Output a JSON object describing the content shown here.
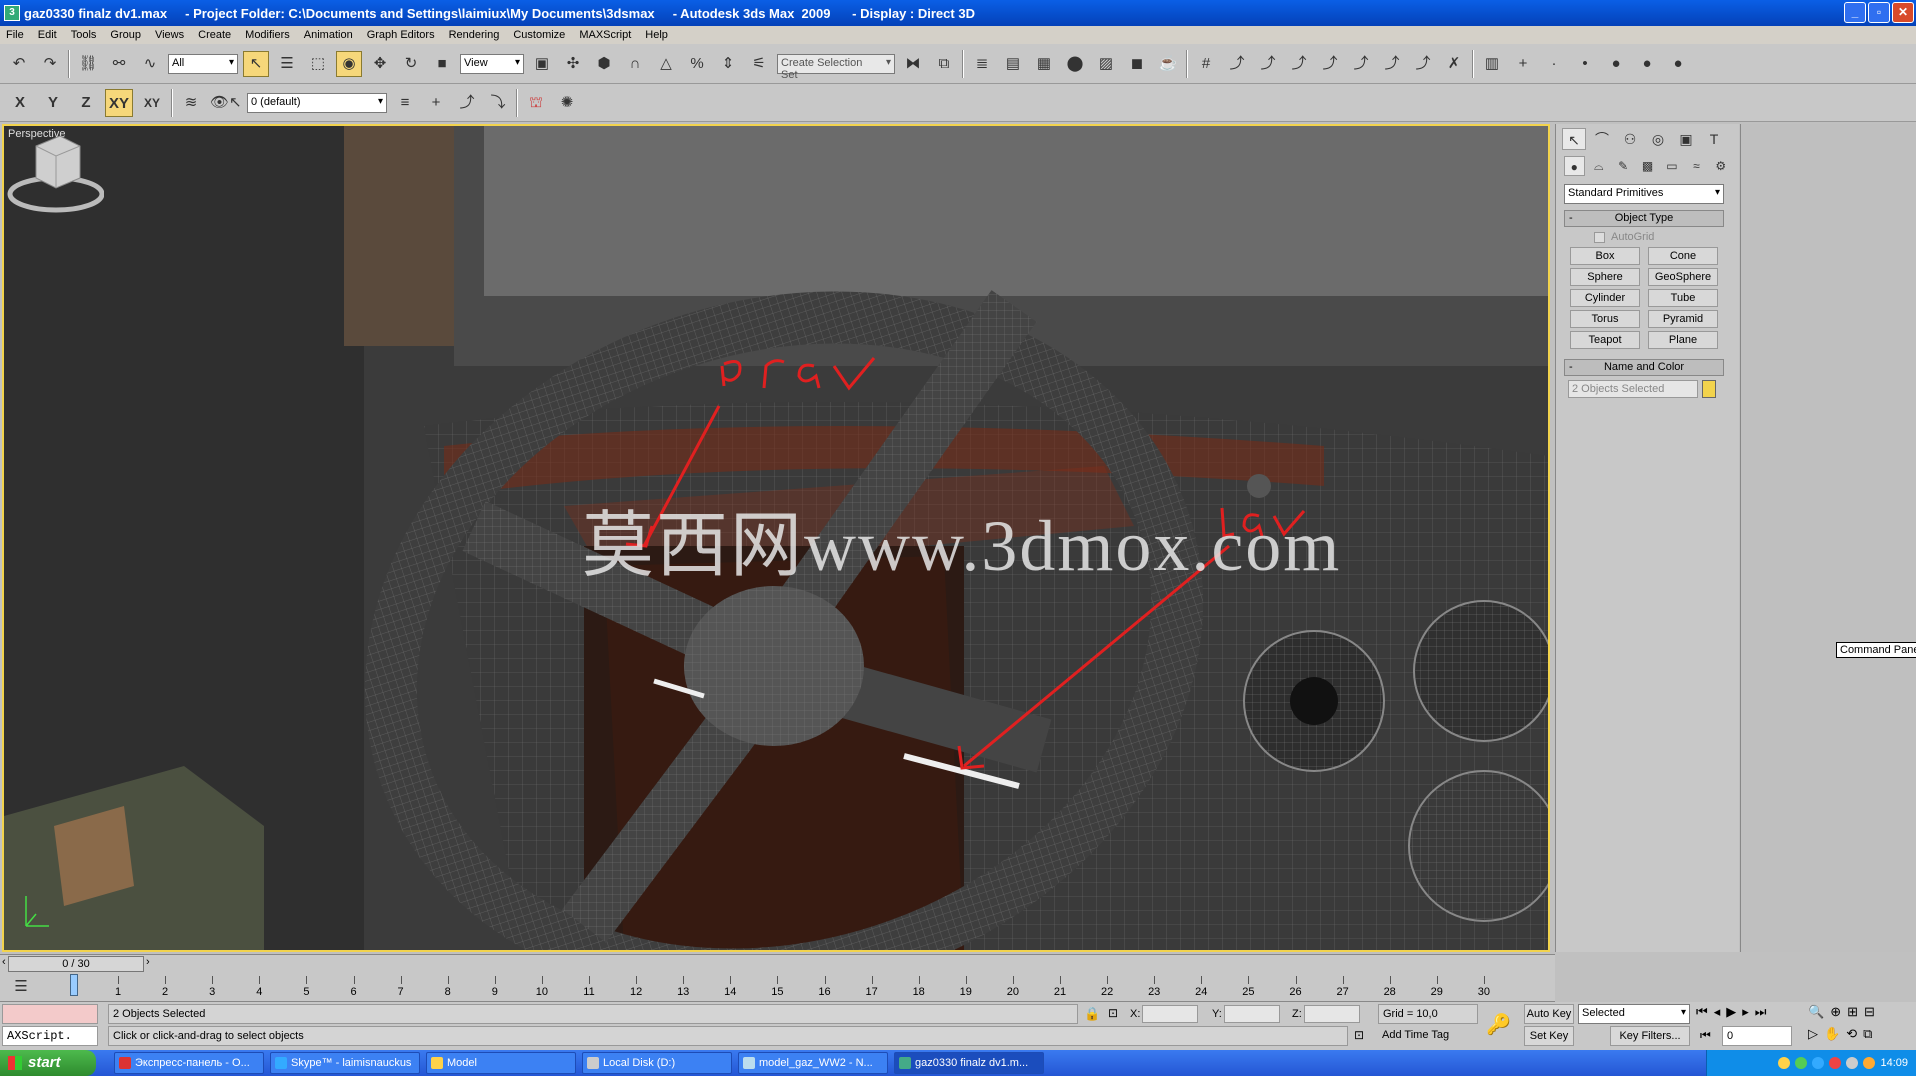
{
  "window": {
    "title": "gaz0330 finalz dv1.max     - Project Folder: C:\\Documents and Settings\\laimiux\\My Documents\\3dsmax     - Autodesk 3ds Max  2009      - Display : Direct 3D"
  },
  "menu": [
    "File",
    "Edit",
    "Tools",
    "Group",
    "Views",
    "Create",
    "Modifiers",
    "Animation",
    "Graph Editors",
    "Rendering",
    "Customize",
    "MAXScript",
    "Help"
  ],
  "toolbar": {
    "selection_filter": "All",
    "ref_coord": "View",
    "named_selection_placeholder": "Create Selection Set",
    "axis_x": "X",
    "axis_y": "Y",
    "axis_z": "Z",
    "axis_xy": "XY",
    "axis_xy_alt": "XY",
    "layer": "0 (default)"
  },
  "viewport": {
    "label": "Perspective",
    "watermark": "莫西网www.3dmox.com",
    "annotations": [
      "prav",
      "lav"
    ]
  },
  "command_panel": {
    "category": "Standard Primitives",
    "object_type_title": "Object Type",
    "autogrid": "AutoGrid",
    "primitives": [
      "Box",
      "Cone",
      "Sphere",
      "GeoSphere",
      "Cylinder",
      "Tube",
      "Torus",
      "Pyramid",
      "Teapot",
      "Plane"
    ],
    "name_color_title": "Name and Color",
    "name_field": "2 Objects Selected",
    "swatch_color": "#f2d34c",
    "tooltip": "Command Panel"
  },
  "time": {
    "slider": "0 / 30",
    "ticks": [
      "1",
      "2",
      "3",
      "4",
      "5",
      "6",
      "7",
      "8",
      "9",
      "10",
      "11",
      "12",
      "13",
      "14",
      "15",
      "16",
      "17",
      "18",
      "19",
      "20",
      "21",
      "22",
      "23",
      "24",
      "25",
      "26",
      "27",
      "28",
      "29",
      "30"
    ]
  },
  "status": {
    "maxscript": "AXScript.",
    "selection": "2 Objects Selected",
    "prompt": "Click or click-and-drag to select objects",
    "x_label": "X:",
    "y_label": "Y:",
    "z_label": "Z:",
    "grid": "Grid = 10,0",
    "add_time_tag": "Add Time Tag",
    "auto_key": "Auto Key",
    "set_key": "Set Key",
    "selected_dd": "Selected",
    "key_filters": "Key Filters...",
    "frame": "0"
  },
  "taskbar": {
    "start": "start",
    "items": [
      "Экспресс-панель - О...",
      "Skype™ - laimisnauckus",
      "Model",
      "Local Disk (D:)",
      "model_gaz_WW2 - N...",
      "gaz0330 finalz dv1.m..."
    ],
    "clock": "14:09"
  }
}
